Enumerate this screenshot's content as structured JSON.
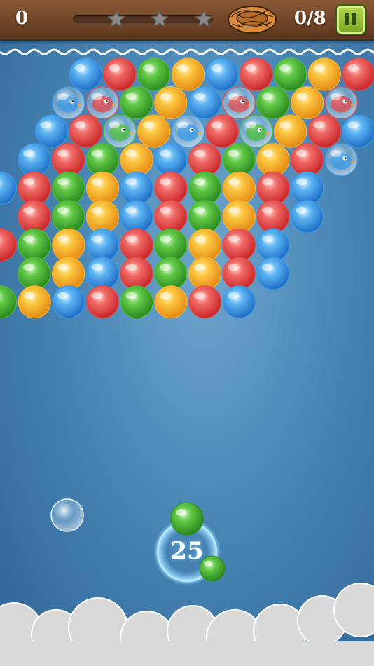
{
  "hud": {
    "score": "0",
    "stars_total": 3,
    "stars_earned": 0,
    "birds_saved": "0/8",
    "pause_icon": "pause-icon",
    "nest_icon": "nest-icon"
  },
  "shooter": {
    "shots_left": "25",
    "current_bubble": "green",
    "next_bubble": "green"
  },
  "colors": {
    "red": "#e84a4a",
    "blue": "#3c9be6",
    "green": "#4fbf3a",
    "yellow": "#f7b731",
    "wood": "#6e4426",
    "sky": "#4a86b5"
  },
  "grid": {
    "rows": [
      [
        null,
        null,
        "blue",
        "red",
        "green",
        "yellow",
        "blue",
        "red",
        "green",
        "yellow",
        "red"
      ],
      [
        null,
        "blue-bird",
        "red-bird",
        "green",
        "yellow",
        "blue",
        "red-bird",
        "green",
        "yellow",
        "red-bird"
      ],
      [
        null,
        "blue",
        "red",
        "green-bird",
        "yellow",
        "blue-bird",
        "red",
        "green-bird",
        "yellow",
        "red",
        "blue"
      ],
      [
        "blue",
        "red",
        "green",
        "yellow",
        "blue",
        "red",
        "green",
        "yellow",
        "red",
        "blue-bird"
      ],
      [
        "blue",
        "red",
        "green",
        "yellow",
        "blue",
        "red",
        "green",
        "yellow",
        "red",
        "blue"
      ],
      [
        "red",
        "green",
        "yellow",
        "blue",
        "red",
        "green",
        "yellow",
        "red",
        "blue"
      ],
      [
        "red",
        "green",
        "yellow",
        "blue",
        "red",
        "green",
        "yellow",
        "red",
        "blue"
      ],
      [
        "green",
        "yellow",
        "blue",
        "red",
        "green",
        "yellow",
        "red",
        "blue"
      ],
      [
        "green",
        "yellow",
        "blue",
        "red",
        "green",
        "yellow",
        "red",
        "blue"
      ]
    ]
  }
}
